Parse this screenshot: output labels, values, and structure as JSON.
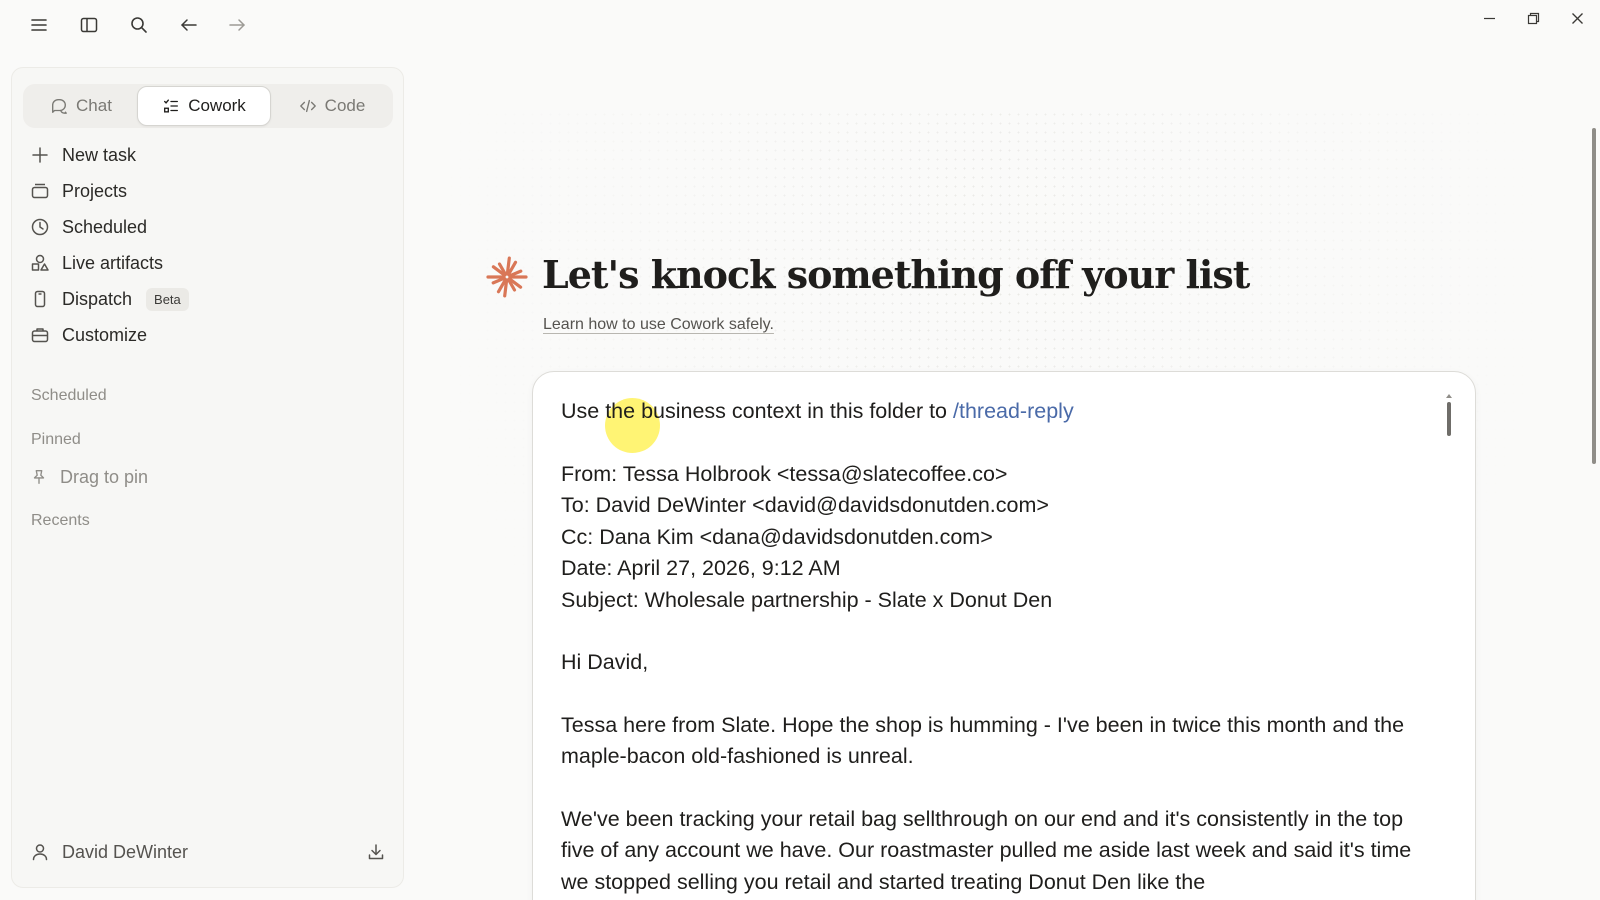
{
  "toolbar": {
    "icons": [
      "menu-icon",
      "sidebar-toggle-icon",
      "search-icon",
      "back-arrow-icon",
      "forward-arrow-icon"
    ]
  },
  "window_controls": [
    "minimize-icon",
    "restore-icon",
    "close-icon"
  ],
  "sidebar": {
    "modes": [
      {
        "label": "Chat",
        "icon": "chat-bubble-icon",
        "active": false
      },
      {
        "label": "Cowork",
        "icon": "checklist-icon",
        "active": true
      },
      {
        "label": "Code",
        "icon": "code-icon",
        "active": false
      }
    ],
    "nav": [
      {
        "label": "New task",
        "icon": "plus-icon"
      },
      {
        "label": "Projects",
        "icon": "folder-icon"
      },
      {
        "label": "Scheduled",
        "icon": "clock-icon"
      },
      {
        "label": "Live artifacts",
        "icon": "shapes-icon"
      },
      {
        "label": "Dispatch",
        "icon": "phone-icon",
        "badge": "Beta"
      },
      {
        "label": "Customize",
        "icon": "briefcase-icon"
      }
    ],
    "sections": {
      "scheduled": "Scheduled",
      "pinned": "Pinned",
      "recents": "Recents"
    },
    "pin_hint": "Drag to pin",
    "user": {
      "name": "David DeWinter"
    }
  },
  "main": {
    "title": "Let's knock something off your list",
    "safety_link": "Learn how to use Cowork safely.",
    "accent_color": "#d97757",
    "prompt": {
      "intro": "Use the business context in this folder to ",
      "command": "/thread-reply",
      "from": "From: Tessa Holbrook <tessa@slatecoffee.co>",
      "to": "To: David DeWinter <david@davidsdonutden.com>",
      "cc": "Cc: Dana Kim <dana@davidsdonutden.com>",
      "date": "Date: April 27, 2026, 9:12 AM",
      "subject": "Subject: Wholesale partnership - Slate x Donut Den",
      "greeting": "Hi David,",
      "para1": "Tessa here from Slate. Hope the shop is humming - I've been in twice this month and the maple-bacon old-fashioned is unreal.",
      "para2": "We've been tracking your retail bag sellthrough on our end and it's consistently in the top five of any account we have. Our roastmaster pulled me aside last week and said it's time we stopped selling you retail and started treating Donut Den like the"
    }
  }
}
